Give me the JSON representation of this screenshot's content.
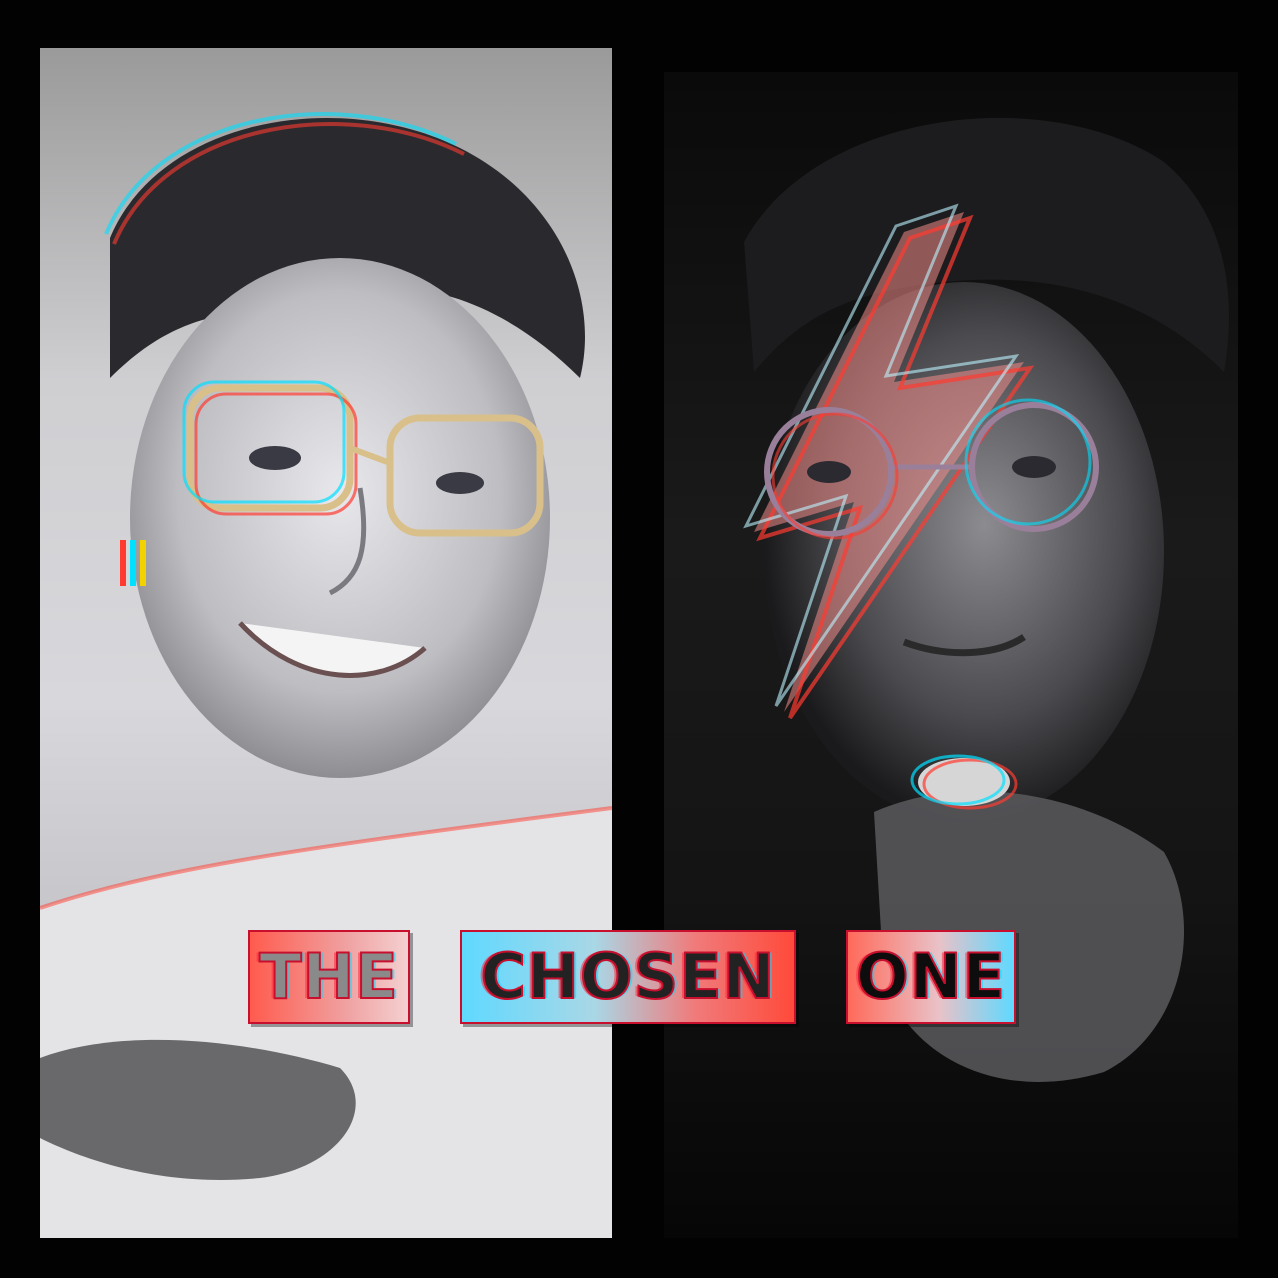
{
  "title": {
    "word1": "THE",
    "word2": "CHOSEN",
    "word3": "ONE"
  },
  "colors": {
    "background": "#000000",
    "accent_red": "#ff3b30",
    "accent_cyan": "#5fd9ff",
    "border_red": "#c8102e"
  },
  "images": {
    "left": "portrait-glasses-smiling-glitch",
    "right": "portrait-round-glasses-lightning-bolt-glitch"
  }
}
